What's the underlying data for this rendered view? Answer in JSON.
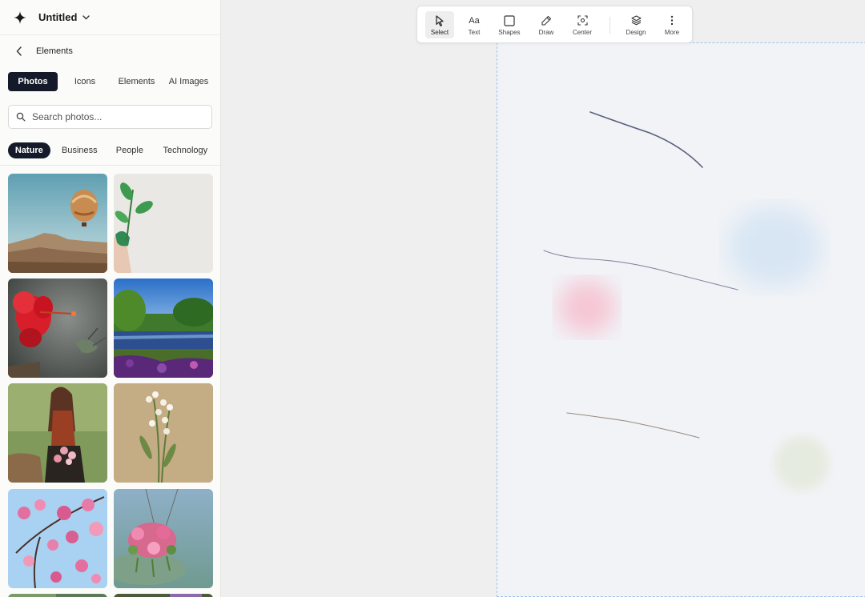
{
  "app": {
    "title": "Untitled"
  },
  "panel": {
    "breadcrumb": "Elements",
    "tabs": [
      "Photos",
      "Icons",
      "Elements",
      "AI Images"
    ],
    "active_tab": "Photos",
    "search": {
      "placeholder": "Search photos...",
      "value": ""
    },
    "chips": [
      "Nature",
      "Business",
      "People",
      "Technology"
    ],
    "active_chip": "Nature",
    "photos": [
      "hot-air-balloon-photo",
      "green-leaf-hand-photo",
      "hibiscus-hummingbird-photo",
      "lake-garden-photo",
      "woman-flowers-photo",
      "white-flowers-photo",
      "pink-blossom-photo",
      "hanging-flowers-photo"
    ]
  },
  "toolbar": {
    "select": "Select",
    "text": "Text",
    "shapes": "Shapes",
    "draw": "Draw",
    "center": "Center",
    "design": "Design",
    "more": "More",
    "text_icon_glyph": "Aa"
  },
  "colors": {
    "accent_dark": "#141a29",
    "canvas_border": "#9ec2ea",
    "canvas_bg": "#f1f3f6"
  }
}
